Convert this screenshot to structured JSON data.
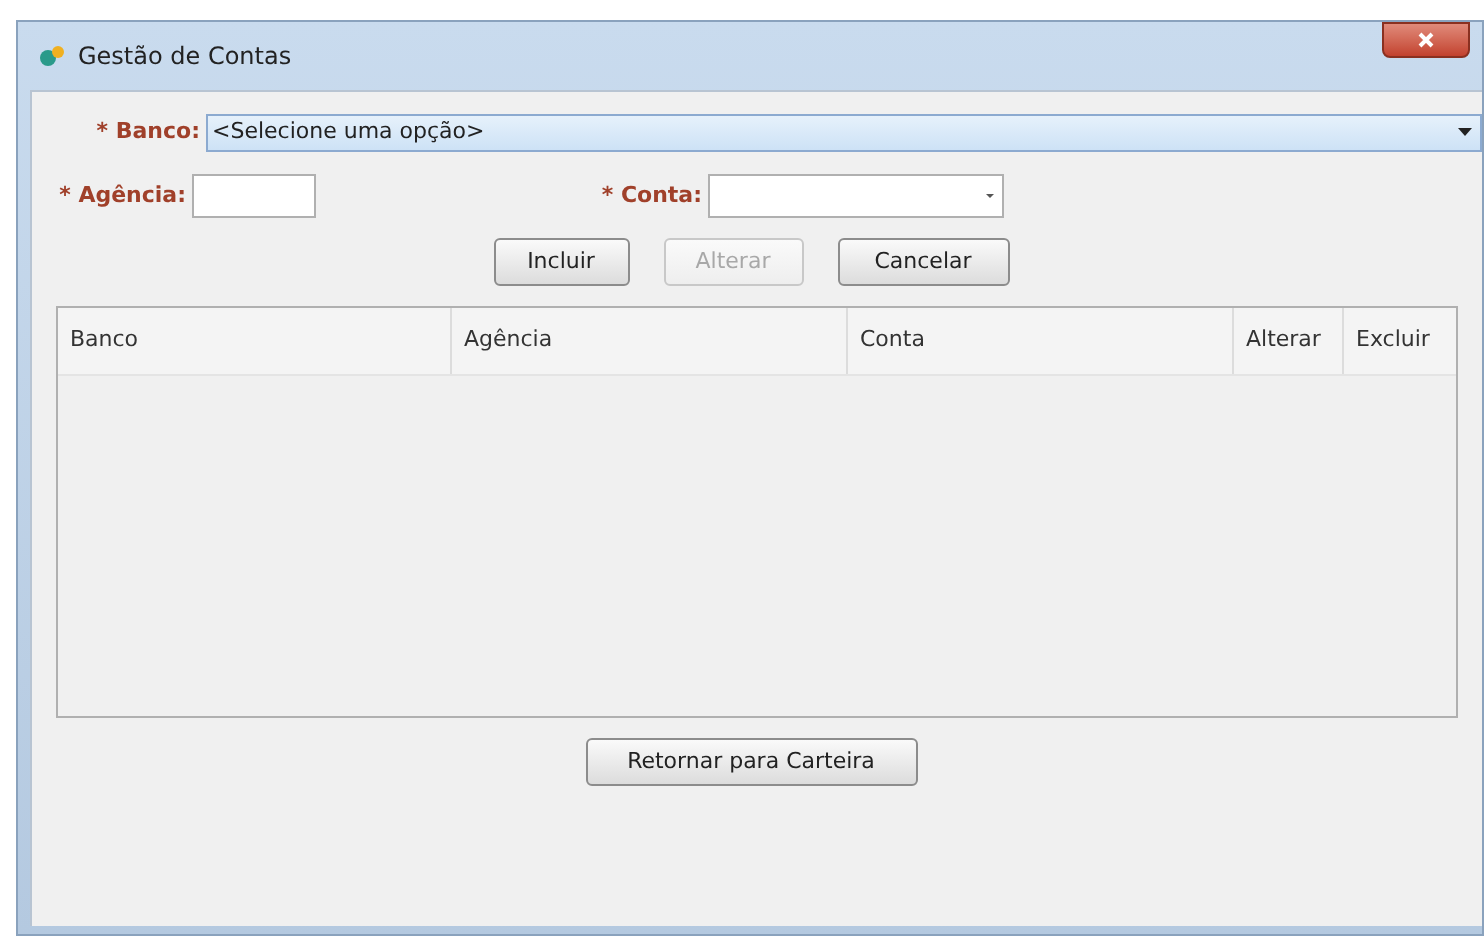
{
  "window": {
    "title": "Gestão de Contas"
  },
  "form": {
    "banco": {
      "label": "* Banco:",
      "value": "<Selecione uma opção>"
    },
    "agencia": {
      "label": "* Agência:"
    },
    "conta": {
      "label": "* Conta:"
    }
  },
  "buttons": [
    {
      "label": "Incluir",
      "disabled": false
    },
    {
      "label": "Alterar",
      "disabled": true
    },
    {
      "label": "Cancelar",
      "disabled": false
    }
  ],
  "table": {
    "columns": [
      "Banco",
      "Agência",
      "Conta",
      "Alterar",
      "Excluir"
    ]
  },
  "footer_button": {
    "label": "Retornar para Carteira"
  }
}
